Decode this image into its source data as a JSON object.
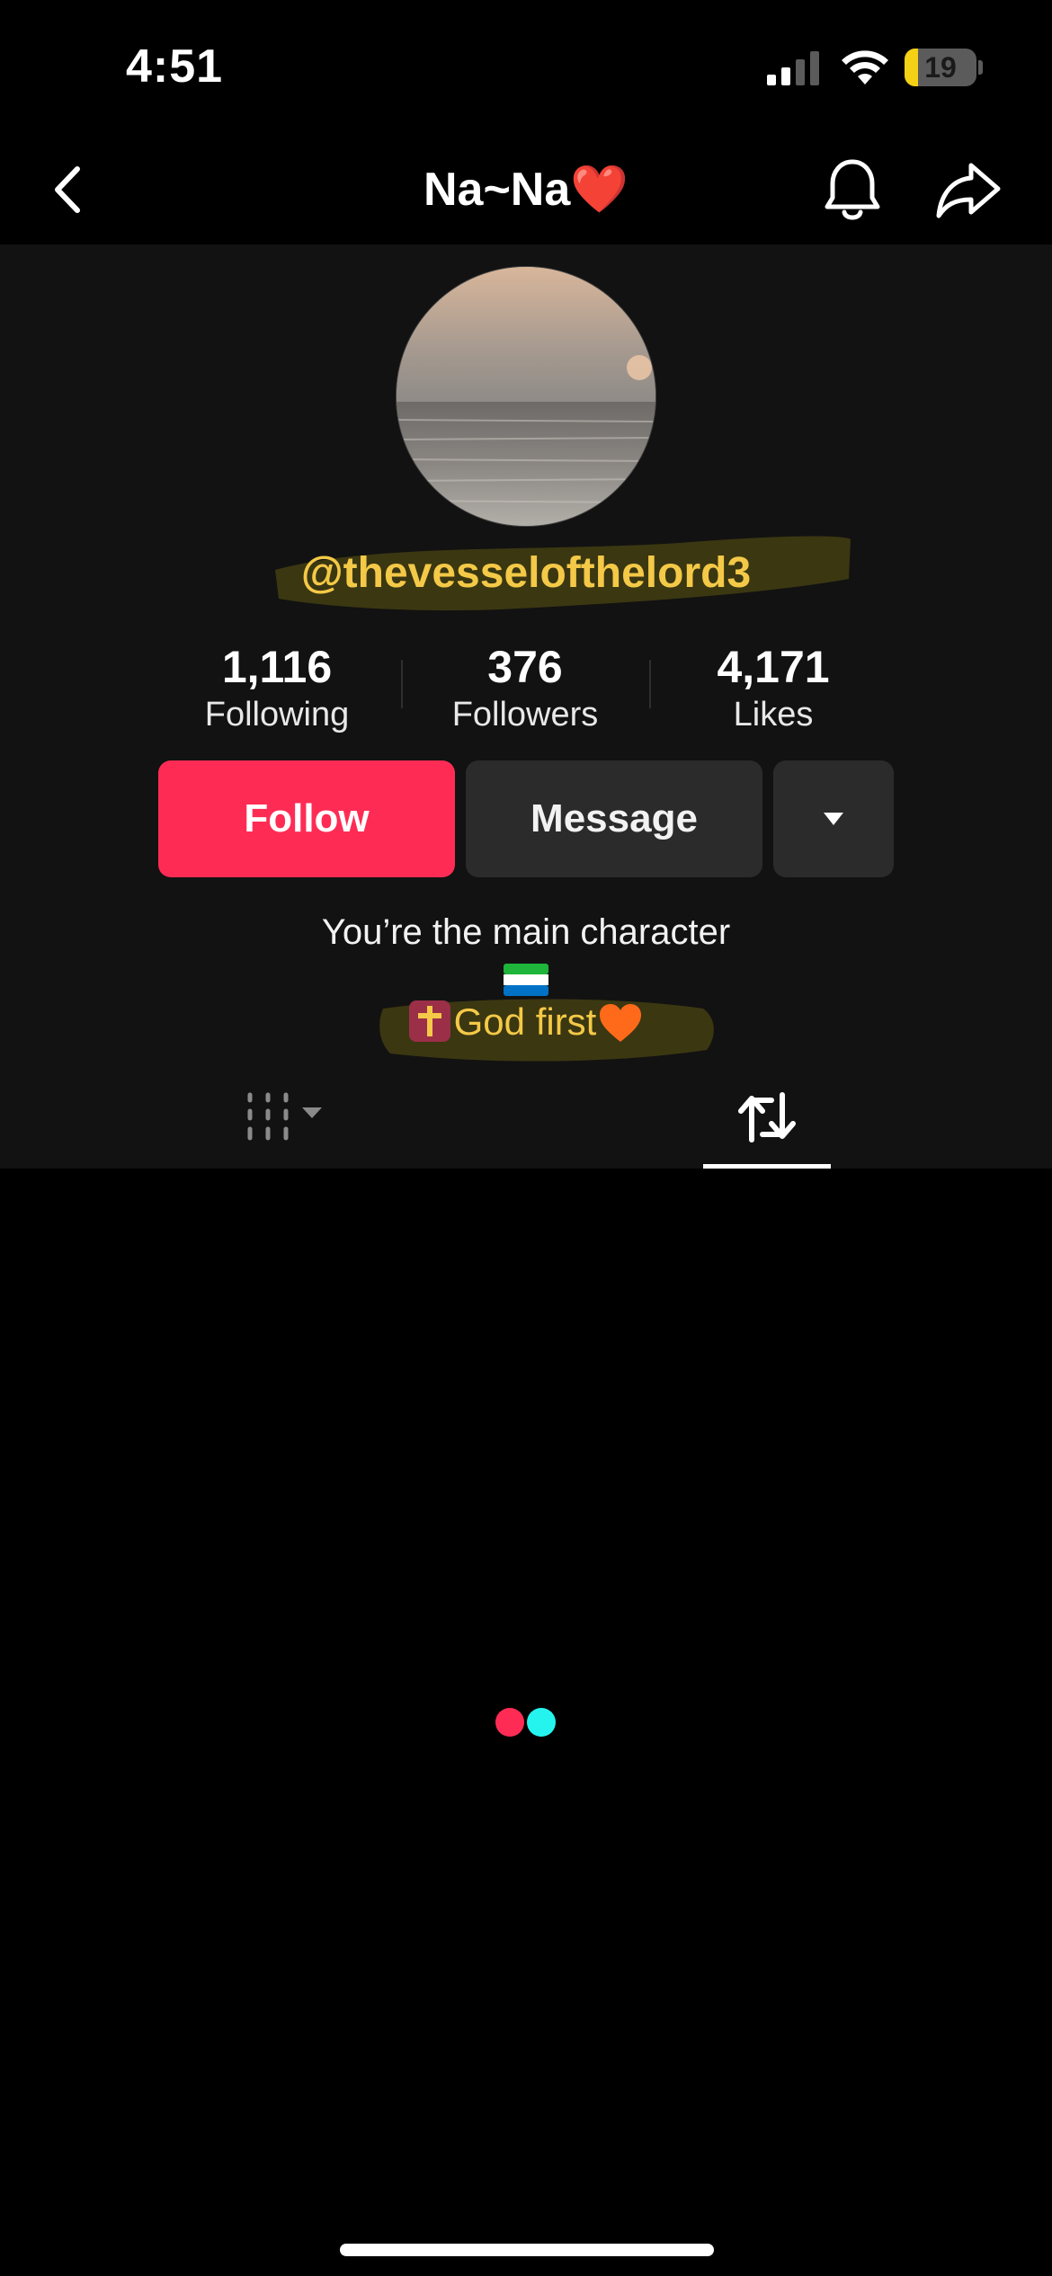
{
  "status_bar": {
    "time": "4:51",
    "battery_level": "19",
    "battery_fraction": 0.19,
    "icons": [
      "cellular-signal-icon",
      "wifi-icon",
      "battery-icon"
    ]
  },
  "nav": {
    "title": "Na~Na❤️",
    "icons": [
      "back-chevron-icon",
      "bell-icon",
      "share-icon"
    ]
  },
  "profile": {
    "username": "@thevesselofthelord3",
    "stats": [
      {
        "value": "1,116",
        "label": "Following"
      },
      {
        "value": "376",
        "label": "Followers"
      },
      {
        "value": "4,171",
        "label": "Likes"
      }
    ],
    "buttons": {
      "follow": "Follow",
      "message": "Message"
    },
    "bio": {
      "line1": "You’re the main character",
      "god_first": "God first"
    }
  },
  "tabs": {
    "icons": [
      "videos-grid-icon",
      "repost-icon"
    ],
    "active": "reposts"
  },
  "colors": {
    "follow": "#fe2c55",
    "highlight": "#f4c947",
    "background": "#121212",
    "loader_red": "#fe2c55",
    "loader_cyan": "#25f4ee"
  }
}
